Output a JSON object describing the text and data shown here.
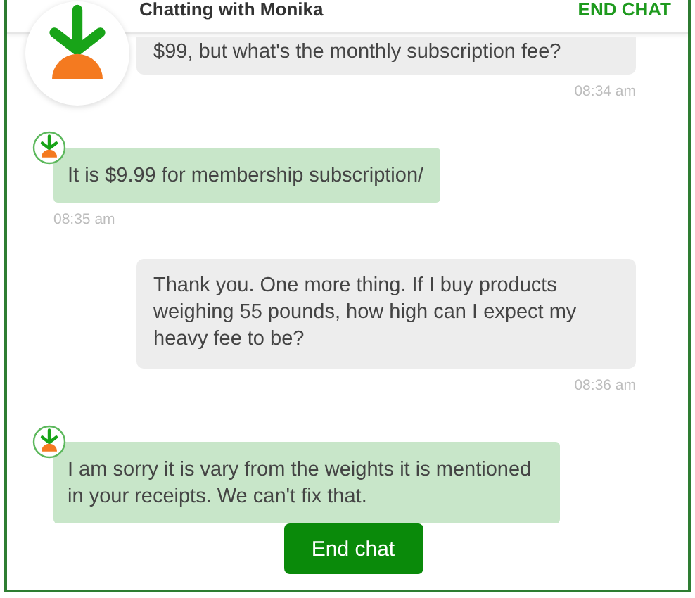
{
  "header": {
    "title": "Chatting with Monika",
    "action": "END CHAT"
  },
  "messages": [
    {
      "kind": "user",
      "text": "$99, but what's the monthly subscription fee?",
      "time": "08:34 am"
    },
    {
      "kind": "agent",
      "text": "It is $9.99 for membership subscription/",
      "time": "08:35 am"
    },
    {
      "kind": "user",
      "text": "Thank you. One more thing. If I buy products weighing 55 pounds, how high can I expect my heavy fee to be?",
      "time": "08:36 am"
    },
    {
      "kind": "agent",
      "text": "I am sorry it is vary from the weights it is mentioned in your receipts. We can't fix that."
    }
  ],
  "button": "End chat"
}
